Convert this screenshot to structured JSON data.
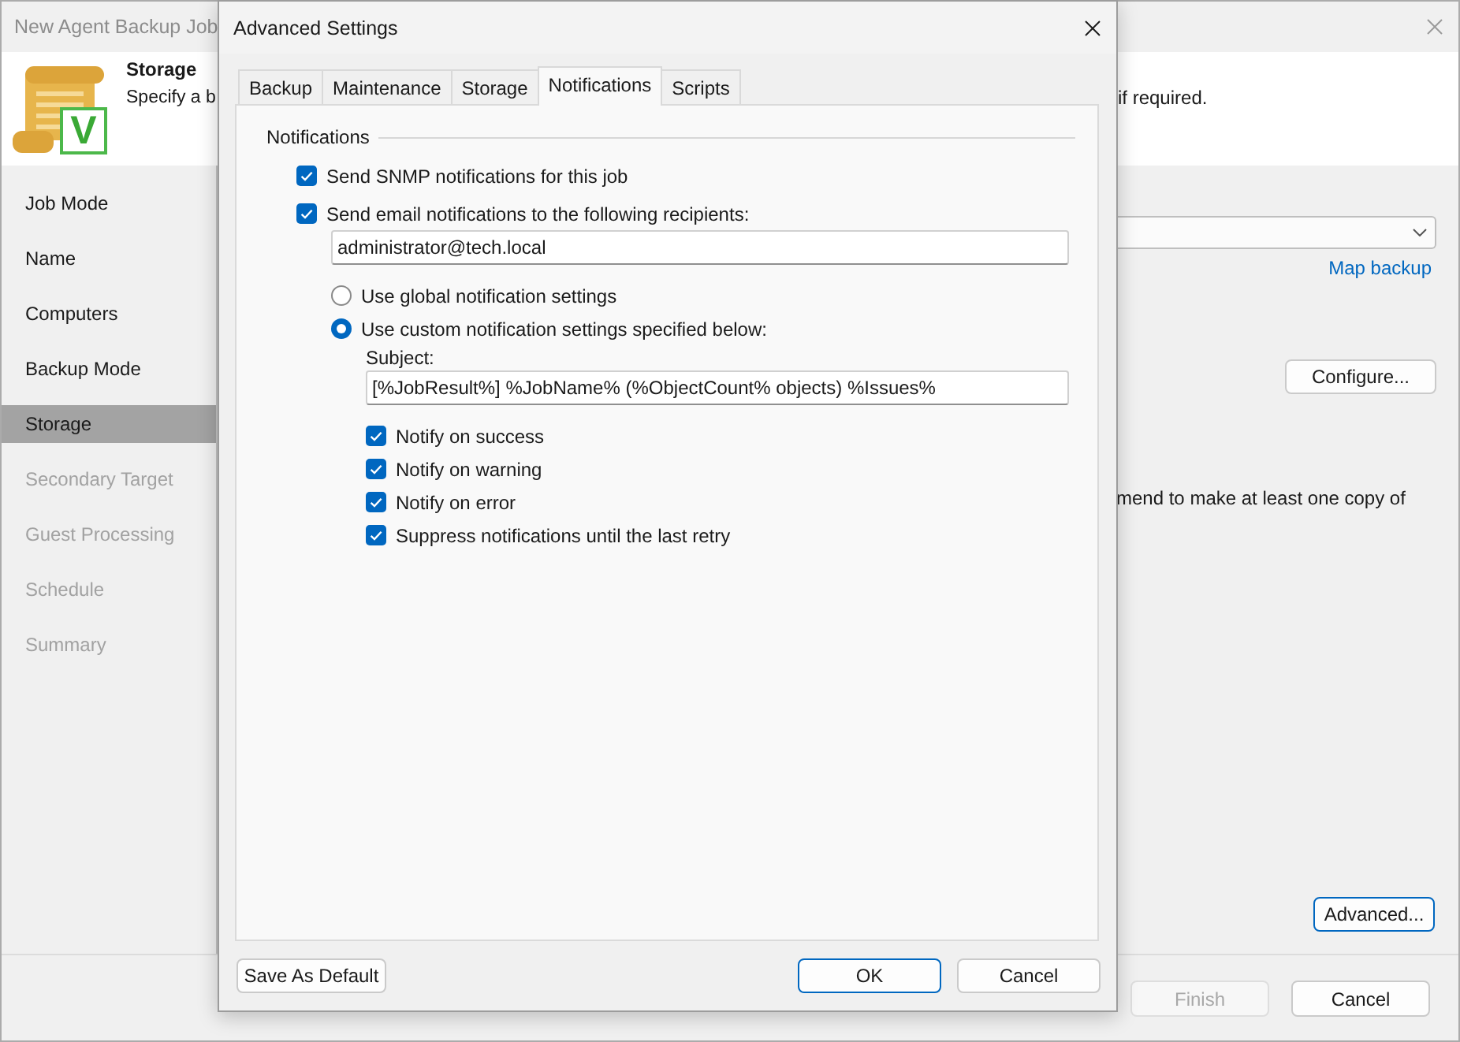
{
  "wizard": {
    "title": "New Agent Backup Job",
    "header": {
      "title": "Storage",
      "description_start": "Specify a b",
      "description_end": "if required.",
      "icon_badge": "V"
    },
    "steps": [
      {
        "label": "Job Mode",
        "selected": false,
        "disabled": false
      },
      {
        "label": "Name",
        "selected": false,
        "disabled": false
      },
      {
        "label": "Computers",
        "selected": false,
        "disabled": false
      },
      {
        "label": "Backup Mode",
        "selected": false,
        "disabled": false
      },
      {
        "label": "Storage",
        "selected": true,
        "disabled": false
      },
      {
        "label": "Secondary Target",
        "selected": false,
        "disabled": true
      },
      {
        "label": "Guest Processing",
        "selected": false,
        "disabled": true
      },
      {
        "label": "Schedule",
        "selected": false,
        "disabled": true
      },
      {
        "label": "Summary",
        "selected": false,
        "disabled": true
      }
    ],
    "content": {
      "map_link": "Map backup",
      "configure_button": {
        "label": "Configure...",
        "focused": false
      },
      "note_fragment": "mend to make at least one copy of",
      "advanced_button": {
        "label": "Advanced...",
        "focused": true
      }
    },
    "footer_buttons": [
      {
        "label": "Finish",
        "disabled": true
      },
      {
        "label": "Cancel",
        "disabled": false
      }
    ]
  },
  "dialog": {
    "title": "Advanced Settings",
    "tabs": [
      {
        "label": "Backup",
        "selected": false
      },
      {
        "label": "Maintenance",
        "selected": false
      },
      {
        "label": "Storage",
        "selected": false
      },
      {
        "label": "Notifications",
        "selected": true
      },
      {
        "label": "Scripts",
        "selected": false
      }
    ],
    "group_title": "Notifications",
    "options": [
      {
        "kind": "checkbox",
        "label": "Send SNMP notifications for this job",
        "checked": true
      },
      {
        "kind": "checkbox",
        "label": "Send email notifications to the following recipients:",
        "checked": true,
        "children": [
          {
            "kind": "field",
            "value": "administrator@tech.local"
          },
          {
            "kind": "radio",
            "label": "Use global notification settings",
            "selected": false
          },
          {
            "kind": "radio",
            "label": "Use custom notification settings specified below:",
            "selected": true,
            "children": [
              {
                "kind": "label",
                "text": "Subject:"
              },
              {
                "kind": "field",
                "value": "[%JobResult%] %JobName% (%ObjectCount% objects) %Issues%"
              },
              {
                "kind": "checkbox",
                "label": "Notify on success",
                "checked": true
              },
              {
                "kind": "checkbox",
                "label": "Notify on warning",
                "checked": true
              },
              {
                "kind": "checkbox",
                "label": "Notify on error",
                "checked": true
              },
              {
                "kind": "checkbox",
                "label": "Suppress notifications until the last retry",
                "checked": true
              }
            ]
          }
        ]
      }
    ],
    "footer_left": [
      {
        "label": "Save As Default",
        "default": false
      }
    ],
    "footer_right": [
      {
        "label": "OK",
        "default": true
      },
      {
        "label": "Cancel",
        "default": false
      }
    ]
  }
}
